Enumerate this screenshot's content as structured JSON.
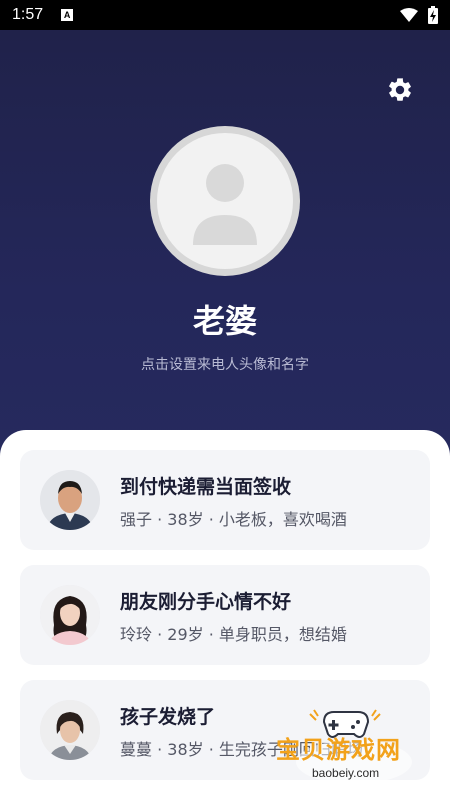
{
  "status_bar": {
    "time": "1:57",
    "notification_icon": "a-letter-icon"
  },
  "header": {
    "settings_icon": "gear-icon"
  },
  "contact": {
    "name": "老婆",
    "hint": "点击设置来电人头像和名字"
  },
  "scenarios": [
    {
      "title": "到付快递需当面签收",
      "desc": "强子 · 38岁 · 小老板，喜欢喝酒"
    },
    {
      "title": "朋友刚分手心情不好",
      "desc": "玲玲 · 29岁 · 单身职员，想结婚"
    },
    {
      "title": "孩子发烧了",
      "desc": "蔓蔓 · 38岁 · 生完孩子刚回归职场"
    }
  ],
  "watermark": {
    "text": "宝贝游戏网",
    "sub": "baobeiy.com"
  },
  "colors": {
    "hero_bg": "#20224a",
    "card_bg": "#f4f5f8",
    "watermark": "#f2a21b"
  }
}
